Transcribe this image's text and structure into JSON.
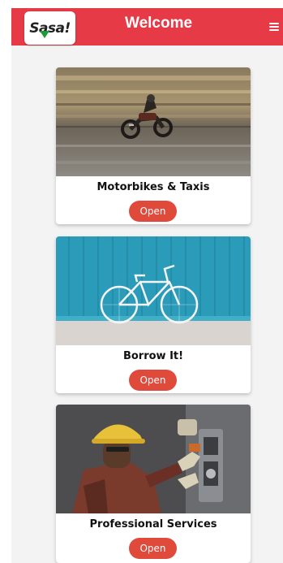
{
  "header": {
    "logo_text": "Sasa!",
    "title": "Welcome",
    "menu_icon": "hamburger-menu-icon"
  },
  "colors": {
    "header_bg": "#e63a47",
    "button_bg": "#e04a3a",
    "logo_arrow": "#1f9a3a",
    "page_bg": "#f3f3f3"
  },
  "cards": [
    {
      "title": "Motorbikes & Taxis",
      "button": "Open",
      "image": "motorcyclist-on-road"
    },
    {
      "title": "Borrow It!",
      "button": "Open",
      "image": "bicycle-against-blue-wall"
    },
    {
      "title": "Professional Services",
      "button": "Open",
      "image": "electrician-with-hard-hat"
    }
  ]
}
